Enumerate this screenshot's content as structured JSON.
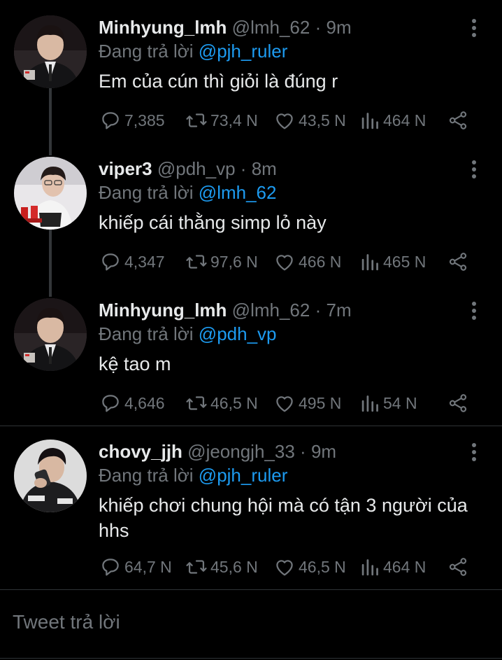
{
  "tweets": [
    {
      "name": "Minhyung_lmh",
      "handle": "@lmh_62",
      "separator": "·",
      "time": "9m",
      "reply_prefix": "Đang trả lời",
      "reply_to": "@pjh_ruler",
      "text": "Em của cún thì giỏi là đúng r",
      "replies": "7,385",
      "retweets": "73,4 N",
      "likes": "43,5 N",
      "views": "464 N"
    },
    {
      "name": "viper3",
      "handle": "@pdh_vp",
      "separator": "·",
      "time": "8m",
      "reply_prefix": "Đang trả lời",
      "reply_to": "@lmh_62",
      "text": "khiếp cái thằng simp lỏ này",
      "replies": "4,347",
      "retweets": "97,6 N",
      "likes": "466 N",
      "views": "465 N"
    },
    {
      "name": "Minhyung_lmh",
      "handle": "@lmh_62",
      "separator": "·",
      "time": "7m",
      "reply_prefix": "Đang trả lời",
      "reply_to": "@pdh_vp",
      "text": "kệ tao m",
      "replies": "4,646",
      "retweets": "46,5 N",
      "likes": "495 N",
      "views": "54 N"
    },
    {
      "name": "chovy_jjh",
      "handle": "@jeongjh_33",
      "separator": "·",
      "time": "9m",
      "reply_prefix": "Đang trả lời",
      "reply_to": "@pjh_ruler",
      "text": "khiếp chơi chung hội mà có tận 3 người của hhs",
      "replies": "64,7 N",
      "retweets": "45,6 N",
      "likes": "46,5 N",
      "views": "464 N"
    }
  ],
  "composer": {
    "placeholder": "Tweet trả lời"
  },
  "colors": {
    "background": "#000000",
    "text": "#e7e9ea",
    "muted": "#71767b",
    "accent": "#1d9bf0",
    "divider": "#2f3336"
  },
  "icons": [
    "reply-icon",
    "retweet-icon",
    "like-icon",
    "views-icon",
    "share-icon",
    "more-icon"
  ]
}
